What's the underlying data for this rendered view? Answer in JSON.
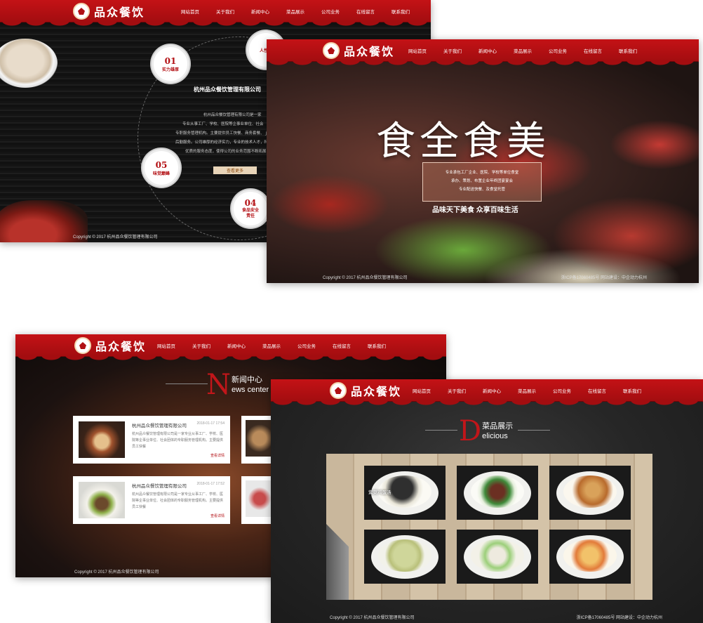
{
  "site": {
    "brand": "品众餐饮",
    "nav": [
      "网站首页",
      "关于我们",
      "新闻中心",
      "菜品展示",
      "公司业务",
      "在线留言",
      "联系我们"
    ],
    "copyright": "Copyright © 2017 杭州品众餐饮管理有限公司",
    "icp": "浙ICP备17060485号 网站建设：中企动力杭州",
    "icp_short": "浙ICP备17060485号 网站建设：中企动力杭州"
  },
  "about": {
    "company": "杭州品众餐饮管理有限公司",
    "desc": [
      "杭州品众餐饮管理有限公司是一家",
      "专业从事工厂、学校、医院等企事业单位、社会",
      "专职服务管理机构。主要提供员工快餐、商务套餐、ｊ",
      "后勤服务。公司雄厚的经济实力，专业的技术人才，科",
      "优质的服务态度，使得公司的业务范围不断拓展"
    ],
    "more": "查看更多",
    "circles": [
      {
        "num": "01",
        "label": "实力雄厚"
      },
      {
        "num": "05",
        "label": "味觉巅峰"
      },
      {
        "num": "04",
        "label": "食品安全\n责任"
      },
      {
        "num": "",
        "label": "人性化"
      }
    ]
  },
  "hero": {
    "title": "食全食美",
    "box": [
      "专业承包工厂企业、医院、学校等单位食堂",
      "承办、策划、布置企业年终团宴宴会",
      "专业配送快餐、及食堂托管"
    ],
    "slogan": "品味天下美食 众享百味生活"
  },
  "news": {
    "letter": "N",
    "zh": "新闻中心",
    "en": "ews center",
    "items": [
      {
        "title": "杭州品众餐饮管理有限公司",
        "date": "2018-01-17 17:54",
        "text": "杭州品众餐饮管理有限公司是一家专业从事工厂、学校、医院等企事业单位、社会团体的专职服务管理机构。主要提供员工快餐",
        "more": "查看详情"
      },
      {
        "title": "杭州品众餐饮管理有限公司",
        "date": "2018-01-17 17:52",
        "text": "杭州品众餐饮管理有限公司是一家专业从事工厂、学校、医院等企事业单位、社会团体的专职服务管理机构。主要提供员工快餐",
        "more": "查看详情"
      }
    ]
  },
  "dishes": {
    "letter": "D",
    "zh": "菜品展示",
    "en": "elicious",
    "items": [
      "紫菜鸡蛋汤",
      "",
      "",
      "",
      "",
      ""
    ]
  },
  "colors": {
    "brand_red": "#b31014",
    "accent": "#c1161a"
  }
}
